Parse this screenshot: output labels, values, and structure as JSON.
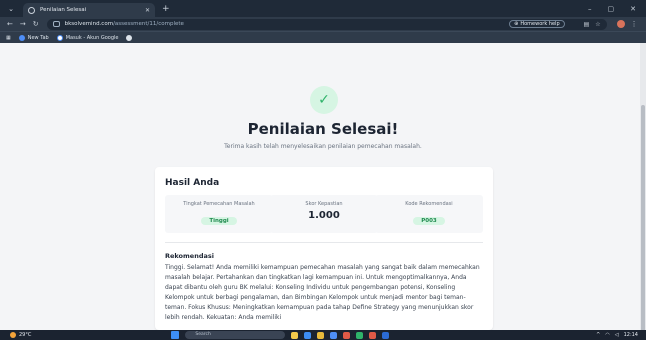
{
  "browser": {
    "tab_title": "Penilaian Selesai",
    "url_host": "bksolvemind.com",
    "url_path": "/assessment/11/complete",
    "homework_help": "Homework help",
    "bookmarks": [
      "New Tab",
      "Masuk - Akun Google"
    ]
  },
  "page": {
    "title": "Penilaian Selesai!",
    "subtitle": "Terima kasih telah menyelesaikan penilaian pemecahan masalah.",
    "results": {
      "heading": "Hasil Anda",
      "stats": [
        {
          "label": "Tingkat Pemecahan Masalah",
          "value": "Tinggi"
        },
        {
          "label": "Skor Kepastian",
          "value": "1.000"
        },
        {
          "label": "Kode Rekomendasi",
          "value": "P003"
        }
      ]
    },
    "recommendation": {
      "heading": "Rekomendasi",
      "text": "Tinggi. Selamat! Anda memiliki kemampuan pemecahan masalah yang sangat baik dalam memecahkan masalah belajar. Pertahankan dan tingkatkan lagi kemampuan ini. Untuk mengoptimalkannya, Anda dapat dibantu oleh guru BK melalui: Konseling Individu untuk pengembangan potensi, Konseling Kelompok untuk berbagi pengalaman, dan Bimbingan Kelompok untuk menjadi mentor bagi teman-teman. Fokus Khusus: Meningkatkan kemampuan pada tahap Define Strategy yang menunjukkan skor lebih rendah. Kekuatan: Anda memiliki"
    }
  },
  "taskbar": {
    "temperature": "29°C",
    "search_placeholder": "Search",
    "time": "12:14"
  },
  "colors": {
    "accent_green": "#2fb36a",
    "badge_green_bg": "#d6f5e3",
    "chrome_dark": "#1f2a38"
  }
}
